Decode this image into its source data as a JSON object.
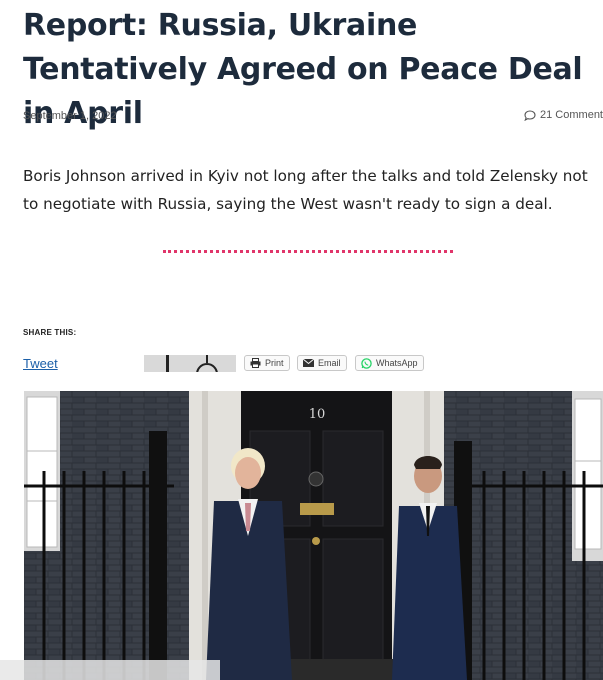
{
  "article": {
    "title": "Report: Russia, Ukraine Tentatively Agreed on Peace Deal in April",
    "date": "September 1, 2022",
    "comments": "21 Comment",
    "excerpt": "Boris Johnson arrived in Kyiv not long after the talks and told Zelensky not to negotiate with Russia, saying the West wasn't ready to sign a deal."
  },
  "share": {
    "title": "SHARE THIS:",
    "tweet": "Tweet",
    "buttons": [
      {
        "label": "Print",
        "icon": "printer-icon"
      },
      {
        "label": "Email",
        "icon": "envelope-icon"
      },
      {
        "label": "WhatsApp",
        "icon": "whatsapp-icon"
      }
    ]
  },
  "photo": {
    "door_number": "10"
  },
  "colors": {
    "headline": "#1d2b3c",
    "divider": "#e0356a",
    "link": "#1b5fa8",
    "whatsapp": "#25d366"
  }
}
